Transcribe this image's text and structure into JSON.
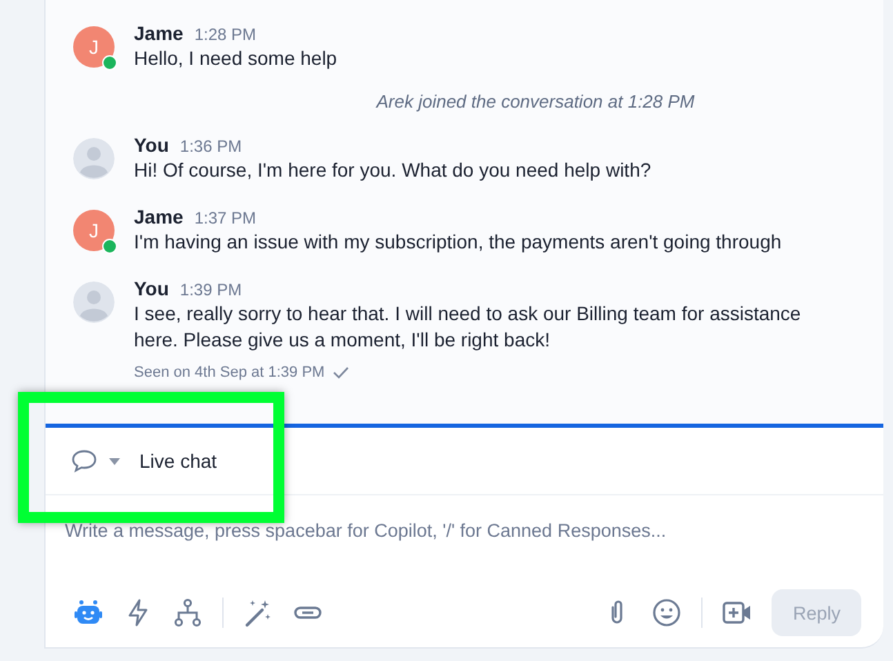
{
  "messages": [
    {
      "kind": "message",
      "author": "Jame",
      "time": "1:28 PM",
      "avatar": {
        "kind": "initial",
        "initial": "J",
        "color": "#f28672"
      },
      "online": true,
      "lines": [
        "Hello, I need some help"
      ]
    },
    {
      "kind": "event",
      "text": "Arek joined the conversation at 1:28 PM"
    },
    {
      "kind": "message",
      "author": "You",
      "time": "1:36 PM",
      "avatar": {
        "kind": "silhouette"
      },
      "online": false,
      "lines": [
        "Hi! Of course, I'm here for you. What do you need help with?"
      ]
    },
    {
      "kind": "message",
      "author": "Jame",
      "time": "1:37 PM",
      "avatar": {
        "kind": "initial",
        "initial": "J",
        "color": "#f28672"
      },
      "online": true,
      "lines": [
        "I'm having an issue with my subscription, the payments aren't going through"
      ]
    },
    {
      "kind": "message",
      "author": "You",
      "time": "1:39 PM",
      "avatar": {
        "kind": "silhouette"
      },
      "online": false,
      "lines": [
        "I see, really sorry to hear that. I will need to ask our Billing team for assistance here. Please give us a moment, I'll be right back!"
      ],
      "seen": "Seen on 4th Sep at 1:39 PM"
    }
  ],
  "channel": {
    "label": "Live chat",
    "highlighted": true
  },
  "composer": {
    "placeholder": "Write a message, press spacebar for Copilot, '/' for Canned Responses..."
  },
  "reply_button": {
    "label": "Reply",
    "disabled": true
  }
}
